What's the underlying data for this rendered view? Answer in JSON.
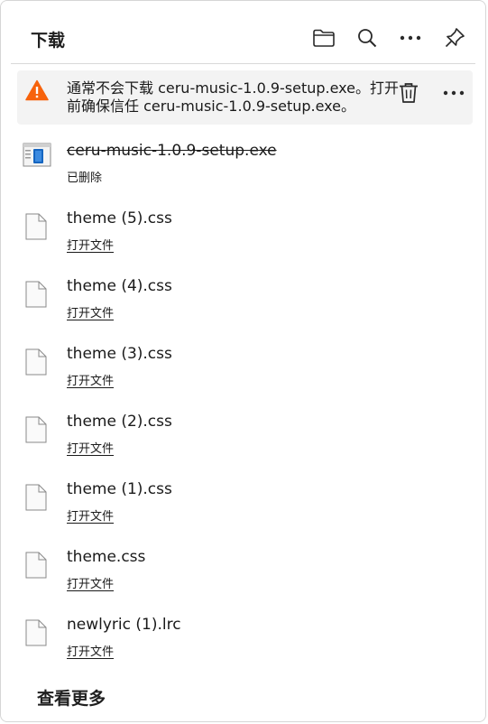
{
  "header": {
    "title": "下载",
    "icons": [
      "folder-icon",
      "search-icon",
      "more-icon",
      "pin-icon"
    ]
  },
  "warning": {
    "line1": "通常不会下载 ceru-music-1.0.9-setup.exe。打开",
    "line2": "前确保信任 ceru-music-1.0.9-setup.exe。",
    "icon": "warning-icon",
    "accent": "#f7630c"
  },
  "downloads": [
    {
      "name": "ceru-music-1.0.9-setup.exe",
      "status": "已删除",
      "deleted": true
    },
    {
      "name": "theme (5).css",
      "status": "打开文件",
      "deleted": false
    },
    {
      "name": "theme (4).css",
      "status": "打开文件",
      "deleted": false
    },
    {
      "name": "theme (3).css",
      "status": "打开文件",
      "deleted": false
    },
    {
      "name": "theme (2).css",
      "status": "打开文件",
      "deleted": false
    },
    {
      "name": "theme (1).css",
      "status": "打开文件",
      "deleted": false
    },
    {
      "name": "theme.css",
      "status": "打开文件",
      "deleted": false
    },
    {
      "name": "newlyric (1).lrc",
      "status": "打开文件",
      "deleted": false
    }
  ],
  "footer": {
    "see_more": "查看更多"
  }
}
